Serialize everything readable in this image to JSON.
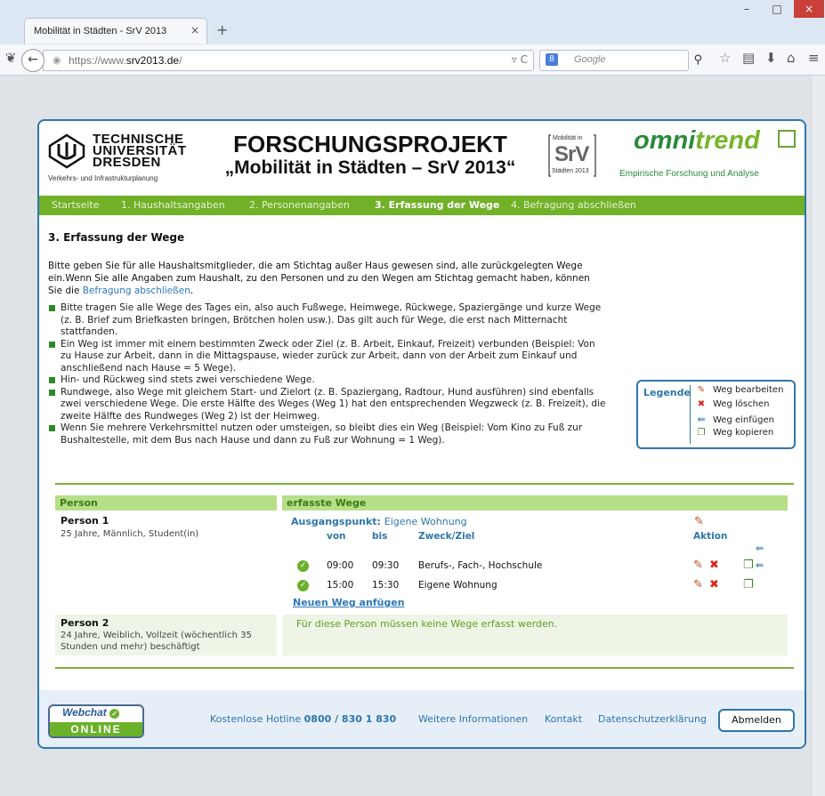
{
  "browser": {
    "tab_title": "Mobilität in Städten - SrV 2013",
    "tab_close": "×",
    "new_tab": "+",
    "url_prefix": "https://www.",
    "url_host": "srv2013.de",
    "url_path": "/",
    "search_placeholder": "Google",
    "search_badge": "8",
    "window_min": "–",
    "window_max": "□",
    "window_close": "×"
  },
  "header": {
    "tu_line1": "TECHNISCHE",
    "tu_line2": "UNIVERSITÄT",
    "tu_line3": "DRESDEN",
    "tu_sub": "Verkehrs- und Infrastrukturplanung",
    "project_line1": "FORSCHUNGSPROJEKT",
    "project_line2": "„Mobilität in Städten – SrV 2013“",
    "srv_top": "Mobilität in",
    "srv_mid": "SrV",
    "srv_bot": "Städten 2013",
    "omni_a": "omni",
    "omni_b": "trend",
    "omni_sub": "Empirische Forschung und Analyse"
  },
  "nav": {
    "items": [
      {
        "label": "Startseite"
      },
      {
        "label": "1. Haushaltsangaben"
      },
      {
        "label": "2. Personenangaben"
      },
      {
        "label": "3. Erfassung der Wege"
      },
      {
        "label": "4. Befragung abschließen"
      }
    ]
  },
  "content": {
    "title": "3. Erfassung der Wege",
    "intro_text": "Bitte geben Sie für alle Haushaltsmitglieder, die am Stichtag außer Haus gewesen sind, alle zurückgelegten Wege ein.Wenn Sie alle Angaben zum Haushalt, zu den Personen und zu den Wegen am Stichtag gemacht haben, können Sie die ",
    "intro_link": "Befragung abschließen",
    "intro_end": ".",
    "bullets": [
      "Bitte tragen Sie alle Wege des Tages ein, also auch Fußwege, Heimwege, Rückwege, Spaziergänge und kurze Wege (z. B. Brief zum Briefkasten bringen, Brötchen holen usw.). Das gilt auch für Wege, die erst nach Mitternacht stattfanden.",
      "Ein Weg ist immer mit einem bestimmten Zweck oder Ziel (z. B. Arbeit, Einkauf, Freizeit) verbunden (Beispiel: Von zu Hause zur Arbeit, dann in die Mittagspause, wieder zurück zur Arbeit, dann von der Arbeit zum Einkauf und anschließend nach Hause = 5 Wege).",
      "Hin- und Rückweg sind stets zwei verschiedene Wege.",
      "Rundwege, also Wege mit gleichem Start- und Zielort (z. B. Spaziergang, Radtour, Hund ausführen) sind ebenfalls zwei verschiedene Wege. Die erste Hälfte des Weges (Weg 1) hat den entsprechenden Wegzweck (z. B. Freizeit), die zweite Hälfte des Rundweges (Weg 2) ist der Heimweg.",
      "Wenn Sie mehrere Verkehrsmittel nutzen oder umsteigen, so bleibt dies ein Weg (Beispiel: Vom Kino zu Fuß zur Bushaltestelle, mit dem Bus nach Hause und dann zu Fuß zur Wohnung = 1 Weg)."
    ]
  },
  "legend": {
    "title": "Legende",
    "items": [
      {
        "icon": "pencil-icon",
        "glyph": "✎",
        "label": "Weg bearbeiten"
      },
      {
        "icon": "delete-icon",
        "glyph": "✖",
        "label": "Weg löschen"
      },
      {
        "icon": "insert-icon",
        "glyph": "⇚",
        "label": "Weg einfügen"
      },
      {
        "icon": "copy-icon",
        "glyph": "❐",
        "label": "Weg kopieren"
      }
    ]
  },
  "table": {
    "col_person": "Person",
    "col_wege": "erfasste Wege",
    "person1": {
      "name": "Person 1",
      "info": "25 Jahre, Männlich, Student(in)",
      "start_label": "Ausgangspunkt:",
      "start_value": "Eigene Wohnung",
      "headers": {
        "von": "von",
        "bis": "bis",
        "zweck": "Zweck/Ziel",
        "aktion": "Aktion"
      },
      "trips": [
        {
          "von": "09:00",
          "bis": "09:30",
          "zweck": "Berufs-, Fach-, Hochschule"
        },
        {
          "von": "15:00",
          "bis": "15:30",
          "zweck": "Eigene Wohnung"
        }
      ],
      "add_link": "Neuen Weg anfügen"
    },
    "person2": {
      "name": "Person 2",
      "info": "24 Jahre, Weiblich, Vollzeit (wöchentlich 35 Stunden und mehr) beschäftigt",
      "message": "Für diese Person müssen keine Wege erfasst werden."
    }
  },
  "icons": {
    "pencil": "✎",
    "delete": "✖",
    "copy": "❐",
    "insert": "⇚",
    "check": "✓"
  },
  "footer": {
    "webchat_top": "Webchat",
    "webchat_bottom": "ONLINE",
    "hotline_label": "Kostenlose Hotline",
    "hotline_number": "0800 / 830 1 830",
    "info": "Weitere Informationen",
    "contact": "Kontakt",
    "privacy": "Datenschutzerklärung",
    "logout": "Abmelden"
  },
  "colors": {
    "accent_green": "#71b027",
    "accent_blue": "#2e77a8",
    "header_green": "#b6df87"
  }
}
